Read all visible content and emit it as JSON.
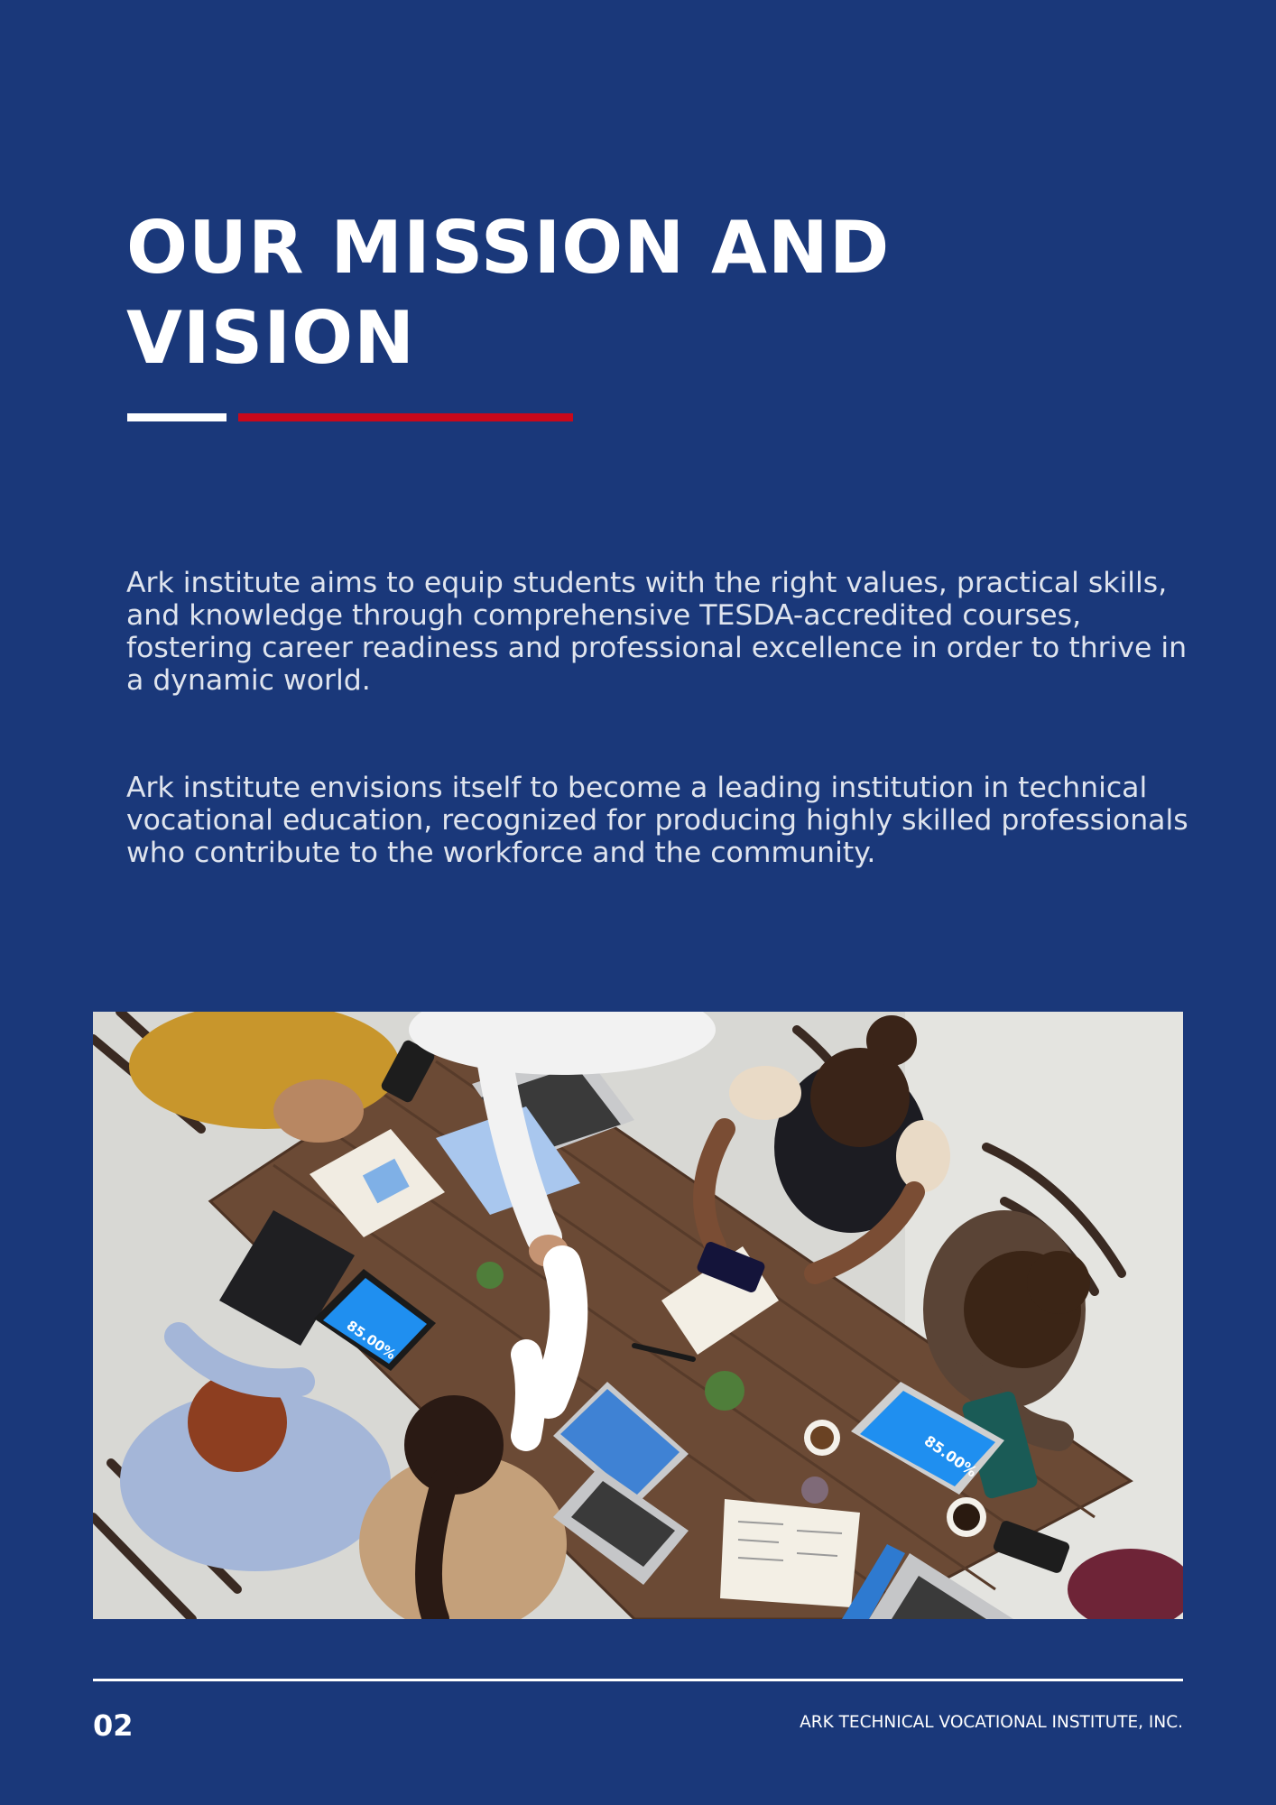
{
  "page": {
    "title_line1": "OUR MISSION AND",
    "title_line2": "VISION",
    "mission_text": "Ark institute aims to equip students with the right values, practical skills, and knowledge through comprehensive TESDA-accredited courses, fostering career readiness and professional excellence in order to thrive in a dynamic world.",
    "vision_text": "Ark institute envisions itself to become a leading institution in technical vocational education, recognized for producing highly skilled professionals who contribute to the workforce and the community."
  },
  "photo": {
    "tablet_left_stat": "85.00%",
    "tablet_right_stat": "85.00%"
  },
  "footer": {
    "page_number": "02",
    "organization": "ARK TECHNICAL VOCATIONAL INSTITUTE, INC."
  },
  "colors": {
    "background": "#1a387a",
    "accent_red": "#c8081b",
    "text_white": "#ffffff"
  }
}
